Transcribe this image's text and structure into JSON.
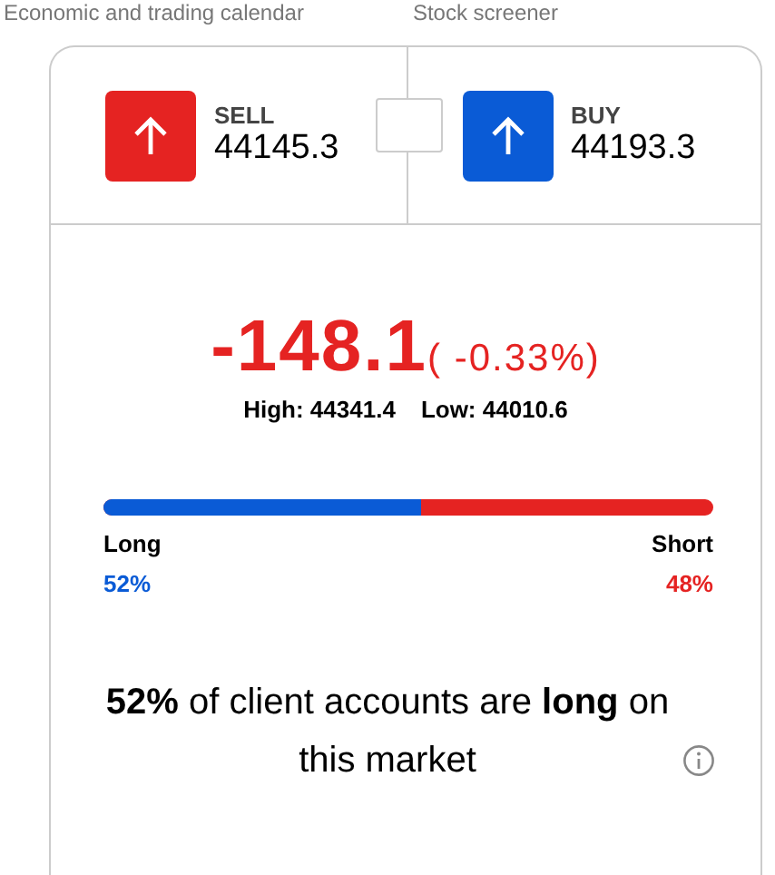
{
  "nav": [
    {
      "label": "Economic and trading calendar"
    },
    {
      "label": "Stock screener"
    }
  ],
  "prices": [
    {
      "kind": "sell",
      "label": "SELL",
      "value": "44145.3"
    },
    {
      "kind": "buy",
      "label": "BUY",
      "value": "44193.3"
    }
  ],
  "change": {
    "value": "-148.1",
    "percent": "( -0.33%)"
  },
  "range": {
    "high": "High: 44341.4",
    "low": "Low: 44010.6"
  },
  "sentiment": {
    "level": 0.52,
    "long_label": "Long",
    "long_value": "52%",
    "short_label": "Short",
    "short_value": "48%"
  },
  "summary": "**52%** of client accounts are **long** on this market"
}
